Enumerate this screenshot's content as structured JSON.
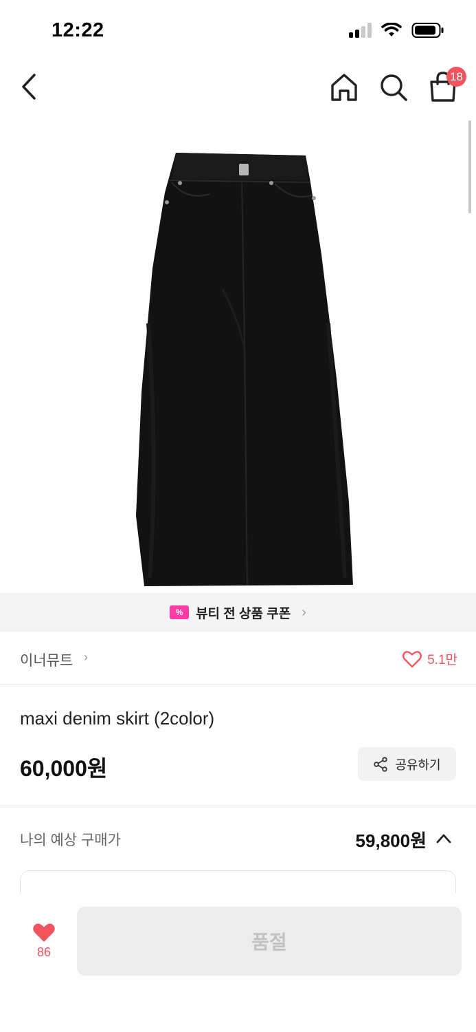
{
  "status_bar": {
    "time": "12:22"
  },
  "nav": {
    "cart_count": "18"
  },
  "coupon": {
    "icon_text": "%",
    "text": "뷰티 전 상품 쿠폰"
  },
  "brand": {
    "name": "이너뮤트",
    "like_count": "5.1만"
  },
  "product": {
    "title": "maxi denim skirt (2color)",
    "price": "60,000원",
    "share_label": "공유하기"
  },
  "expected_price": {
    "label": "나의 예상 구매가",
    "value": "59,800원"
  },
  "bottom": {
    "wish_count": "86",
    "soldout_label": "품절"
  },
  "colors": {
    "accent": "#f2545f",
    "coupon_pink": "#ff3aa4",
    "banner_bg": "#f4f4f4"
  },
  "icons": [
    "chevron-left-icon",
    "home-icon",
    "search-icon",
    "shopping-bag-icon",
    "ticket-icon",
    "heart-outline-icon",
    "share-icon",
    "chevron-up-icon",
    "heart-filled-icon"
  ]
}
